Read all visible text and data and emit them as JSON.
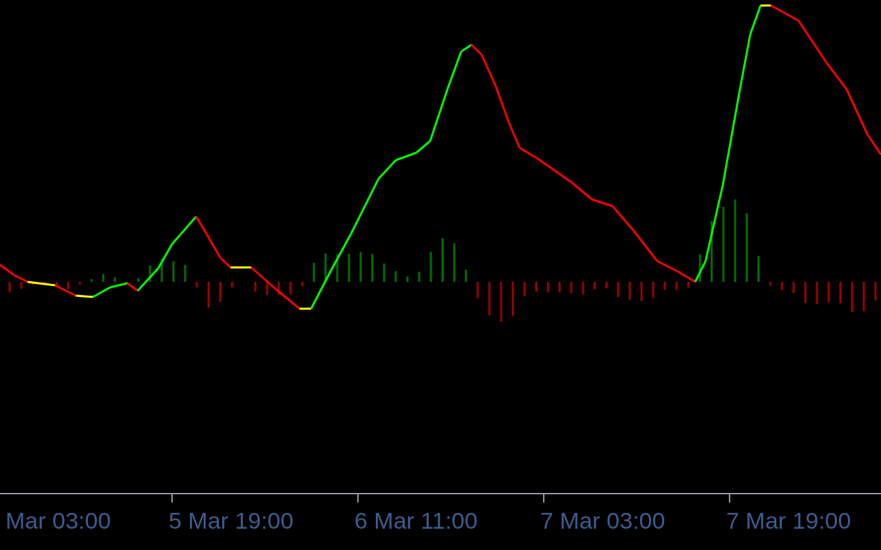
{
  "time_axis": {
    "labels": [
      "Mar 03:00",
      "5 Mar 19:00",
      "6 Mar 11:00",
      "7 Mar 03:00",
      "7 Mar 19:00"
    ]
  }
}
